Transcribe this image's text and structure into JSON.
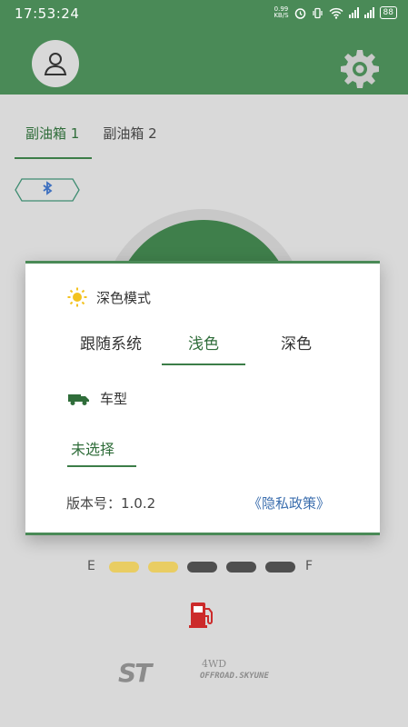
{
  "status_bar": {
    "time": "17:53:24",
    "net_speed_value": "0.99",
    "net_speed_unit": "KB/S",
    "battery": "88"
  },
  "tabs": [
    {
      "label": "副油箱 1",
      "active": true
    },
    {
      "label": "副油箱 2",
      "active": false
    }
  ],
  "dialog": {
    "theme_title": "深色模式",
    "theme_options": [
      "跟随系统",
      "浅色",
      "深色"
    ],
    "theme_selected": "浅色",
    "vehicle_title": "车型",
    "vehicle_value": "未选择",
    "version_text": "版本号：1.0.2",
    "privacy_link": "《隐私政策》"
  },
  "fuel_level": {
    "empty_label": "E",
    "full_label": "F",
    "segments_total": 5,
    "segments_filled": 2
  },
  "brand": {
    "line1": "4WD",
    "line2": "OFFROAD.SKYUNE"
  },
  "colors": {
    "brand_green": "#4a8a57",
    "active_text": "#2f6d3a",
    "link_blue": "#3b6eae",
    "segment_filled": "#e9cd63",
    "segment_empty": "#4f4f4f",
    "fuel_pump": "#cc2a2a"
  },
  "icons": {
    "avatar": "user-outline-icon",
    "settings": "gear-icon",
    "bluetooth": "bluetooth-icon",
    "theme": "sun-icon",
    "vehicle": "truck-icon",
    "fuel": "fuel-pump-icon"
  }
}
